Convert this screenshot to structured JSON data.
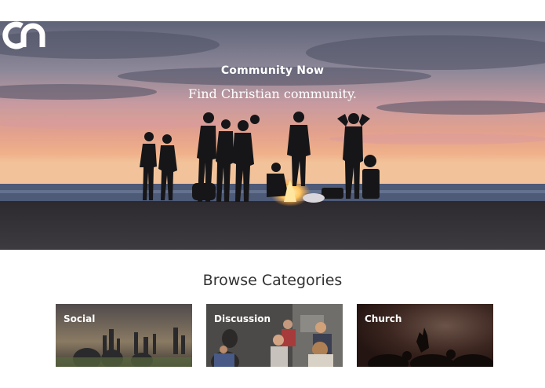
{
  "brand": {
    "name": "Community Now",
    "logo_icon": "cn-logo-icon"
  },
  "hero": {
    "tagline": "Find Christian community."
  },
  "browse": {
    "title": "Browse Categories",
    "categories": [
      {
        "label": "Social"
      },
      {
        "label": "Discussion"
      },
      {
        "label": "Church"
      }
    ]
  },
  "colors": {
    "text_dark": "#333333",
    "white": "#ffffff"
  }
}
